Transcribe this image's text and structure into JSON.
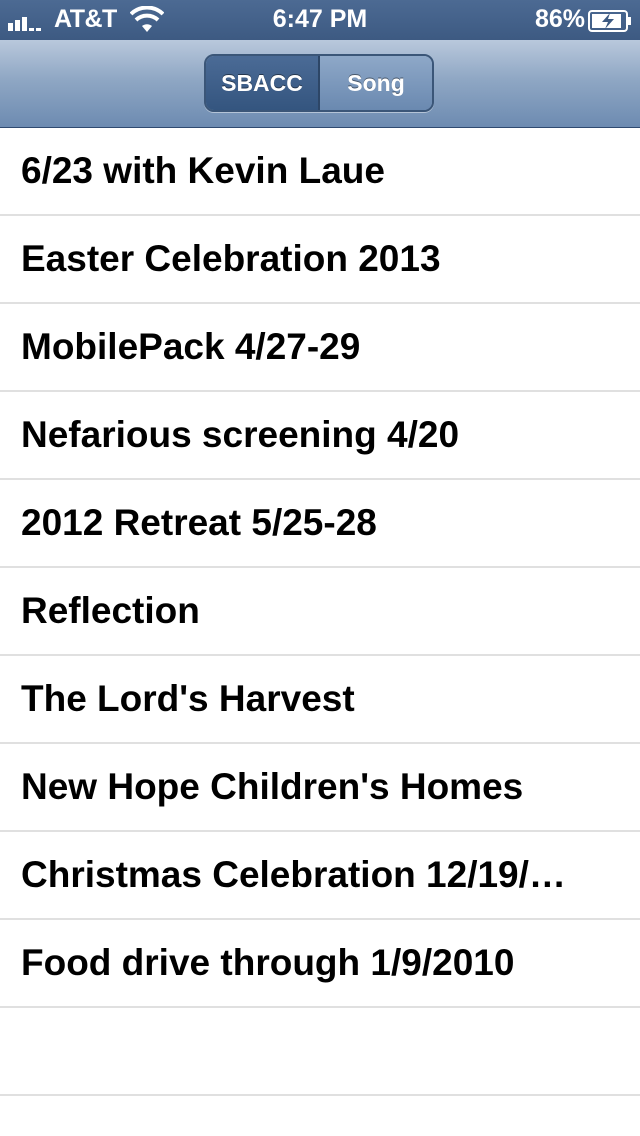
{
  "status_bar": {
    "carrier": "AT&T",
    "time": "6:47 PM",
    "battery_percent": "86%"
  },
  "segmented_control": {
    "segments": [
      {
        "label": "SBACC",
        "selected": true
      },
      {
        "label": "Song",
        "selected": false
      }
    ]
  },
  "list": {
    "items": [
      {
        "label": "6/23 with Kevin Laue"
      },
      {
        "label": "Easter Celebration 2013"
      },
      {
        "label": "MobilePack 4/27-29"
      },
      {
        "label": "Nefarious screening 4/20"
      },
      {
        "label": "2012 Retreat 5/25-28"
      },
      {
        "label": "Reflection"
      },
      {
        "label": "The Lord's Harvest"
      },
      {
        "label": "New Hope Children's Homes"
      },
      {
        "label": "Christmas Celebration 12/19/…"
      },
      {
        "label": "Food drive through 1/9/2010"
      }
    ]
  },
  "colors": {
    "status_bar": "#3d5a82",
    "nav_bar_top": "#b9c8dc",
    "nav_bar_bottom": "#6d8bb1",
    "segment_selected": "#3b5a84",
    "row_separator": "#e0e0e0"
  }
}
